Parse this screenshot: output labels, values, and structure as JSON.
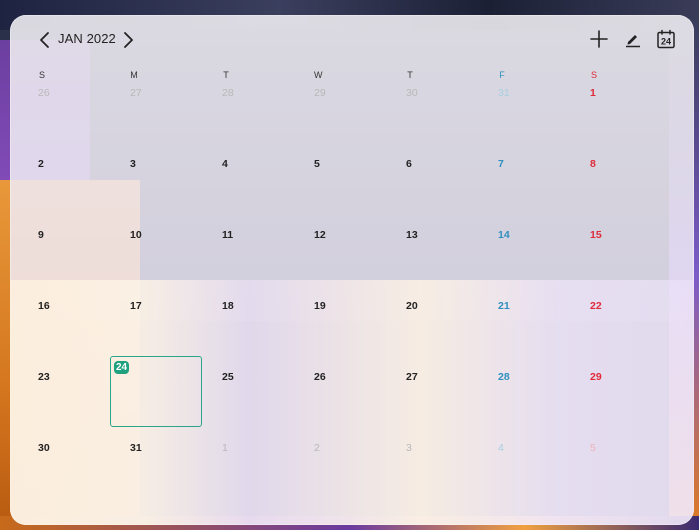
{
  "header": {
    "month_label": "JAN 2022",
    "today_badge": "24"
  },
  "weekdays": [
    "S",
    "M",
    "T",
    "W",
    "T",
    "F",
    "S"
  ],
  "colors": {
    "friday": "#2f8fbf",
    "saturday": "#e02a3a",
    "today_accent": "#1fa07e",
    "other_month": "#b8b8b8"
  },
  "weeks": [
    [
      "26",
      "27",
      "28",
      "29",
      "30",
      "31",
      "1"
    ],
    [
      "2",
      "3",
      "4",
      "5",
      "6",
      "7",
      "8"
    ],
    [
      "9",
      "10",
      "11",
      "12",
      "13",
      "14",
      "15"
    ],
    [
      "16",
      "17",
      "18",
      "19",
      "20",
      "21",
      "22"
    ],
    [
      "23",
      "24",
      "25",
      "26",
      "27",
      "28",
      "29"
    ],
    [
      "30",
      "31",
      "1",
      "2",
      "3",
      "4",
      "5"
    ]
  ],
  "today": "24",
  "icons": {
    "prev": "chevron-left-icon",
    "next": "chevron-right-icon",
    "add": "plus-icon",
    "edit": "pencil-icon",
    "today": "calendar-today-icon"
  }
}
